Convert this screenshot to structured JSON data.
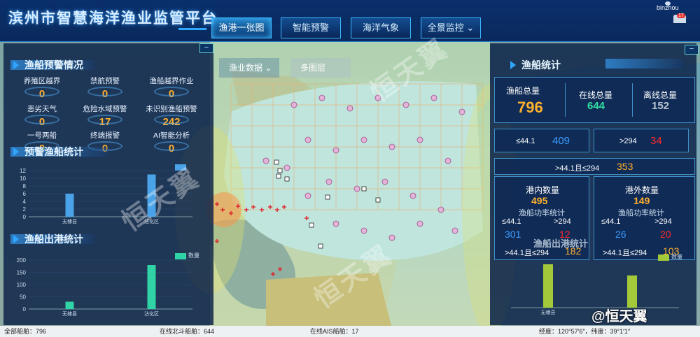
{
  "header": {
    "title": "滨州市智慧海洋渔业监管平台",
    "nav": [
      "渔港一张图",
      "智能预警",
      "海洋气象",
      "全景监控"
    ],
    "user": "binzhou",
    "badge": "17"
  },
  "map_toolbar": {
    "fishery_data": "渔业数据",
    "multi_layer": "多图层"
  },
  "warning": {
    "title": "渔船预警情况",
    "items": [
      {
        "label": "养殖区越界",
        "value": "0"
      },
      {
        "label": "禁航预警",
        "value": "0"
      },
      {
        "label": "渔船越界作业",
        "value": "0"
      },
      {
        "label": "恶劣天气",
        "value": "0"
      },
      {
        "label": "危险水域预警",
        "value": "17"
      },
      {
        "label": "未识别渔船预警",
        "value": "242"
      },
      {
        "label": "一号两船",
        "value": "0"
      },
      {
        "label": "终端报警",
        "value": "0"
      },
      {
        "label": "AI智能分析",
        "value": "0"
      }
    ]
  },
  "warn_stats": {
    "title": "预警渔船统计",
    "legend": "",
    "categories": [
      "无棣县",
      "沾化区"
    ]
  },
  "port_stats": {
    "title": "渔船出港统计",
    "legend": "数量",
    "categories": [
      "无棣县",
      "沾化区"
    ]
  },
  "right": {
    "title": "渔船统计",
    "total_label": "渔船总量",
    "total": "796",
    "online_label": "在线总量",
    "online": "644",
    "offline_label": "离线总量",
    "offline": "152",
    "power_lt_label": "≤44.1",
    "power_lt": "409",
    "power_gt_label": ">294",
    "power_gt": "34",
    "power_mid_label": ">44.1且≤294",
    "power_mid": "353",
    "inport_label": "港内数量",
    "inport": "495",
    "outport_label": "港外数量",
    "outport": "149",
    "sub_title": "渔船功率统计",
    "in_lt": "301",
    "in_gt": "12",
    "in_mid": "182",
    "out_lt": "26",
    "out_gt": "20",
    "out_mid": "103",
    "exit_title": "渔船出港统计",
    "exit_legend": "数量",
    "exit_categories": [
      "无棣县"
    ]
  },
  "footer": {
    "all": "全部船舶：796",
    "bd": "在线北斗船舶：644",
    "ais": "在线AIS船舶：17",
    "coord": "经度：120°57′6″，纬度：39°1′1″"
  },
  "brand": "@恒天翼",
  "watermark": [
    "恒天翼",
    "恒天翼",
    "恒天翼"
  ],
  "chart_data": [
    {
      "type": "bar",
      "title": "预警渔船统计",
      "categories": [
        "无棣县",
        "沾化区"
      ],
      "values": [
        6,
        11
      ],
      "ylim": [
        0,
        12
      ],
      "yticks": [
        "0",
        "2",
        "4",
        "6",
        "8",
        "10",
        "12"
      ]
    },
    {
      "type": "bar",
      "title": "渔船出港统计",
      "categories": [
        "无棣县",
        "沾化区"
      ],
      "values": [
        30,
        180
      ],
      "ylim": [
        0,
        200
      ],
      "yticks": [
        "0",
        "50",
        "100",
        "150",
        "200"
      ]
    }
  ],
  "colors": {
    "accent": "#2ea6ff",
    "orange": "#ffb02e",
    "green": "#33e0a3",
    "red": "#ff2a2a",
    "bar_blue": "#4aa3e8",
    "bar_green": "#2fd3a5",
    "bar_lime": "#a3c93a"
  }
}
